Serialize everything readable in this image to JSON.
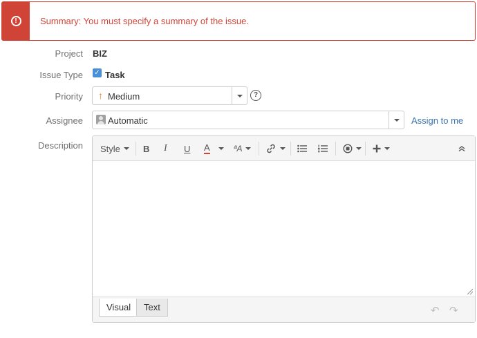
{
  "error": {
    "icon": "error-icon",
    "message": "Summary: You must specify a summary of the issue.",
    "color": "#d04437"
  },
  "form": {
    "project": {
      "label": "Project",
      "value": "BIZ"
    },
    "issue_type": {
      "label": "Issue Type",
      "value": "Task",
      "icon": "task-checkbox-icon"
    },
    "priority": {
      "label": "Priority",
      "value": "Medium",
      "icon": "arrow-up-icon",
      "help_icon": "help-icon"
    },
    "assignee": {
      "label": "Assignee",
      "value": "Automatic",
      "icon": "avatar-icon",
      "assign_link": "Assign to me"
    },
    "description": {
      "label": "Description"
    }
  },
  "editor": {
    "toolbar": {
      "style_label": "Style",
      "bold": "B",
      "italic": "I",
      "underline": "U",
      "text_color": "A",
      "more_formatting": "ªA",
      "link_icon": "link-icon",
      "bullet_list_icon": "bullet-list-icon",
      "numbered_list_icon": "numbered-list-icon",
      "emoticon_icon": "emoticon-icon",
      "insert_icon": "plus-icon",
      "collapse_icon": "collapse-icon"
    },
    "tabs": [
      "Visual",
      "Text"
    ],
    "active_tab": "Visual",
    "undo_icon": "undo-icon",
    "redo_icon": "redo-icon"
  },
  "colors": {
    "accent": "#3b73af",
    "priority": "#e87c1e",
    "text_color_underline": "#d04437"
  }
}
